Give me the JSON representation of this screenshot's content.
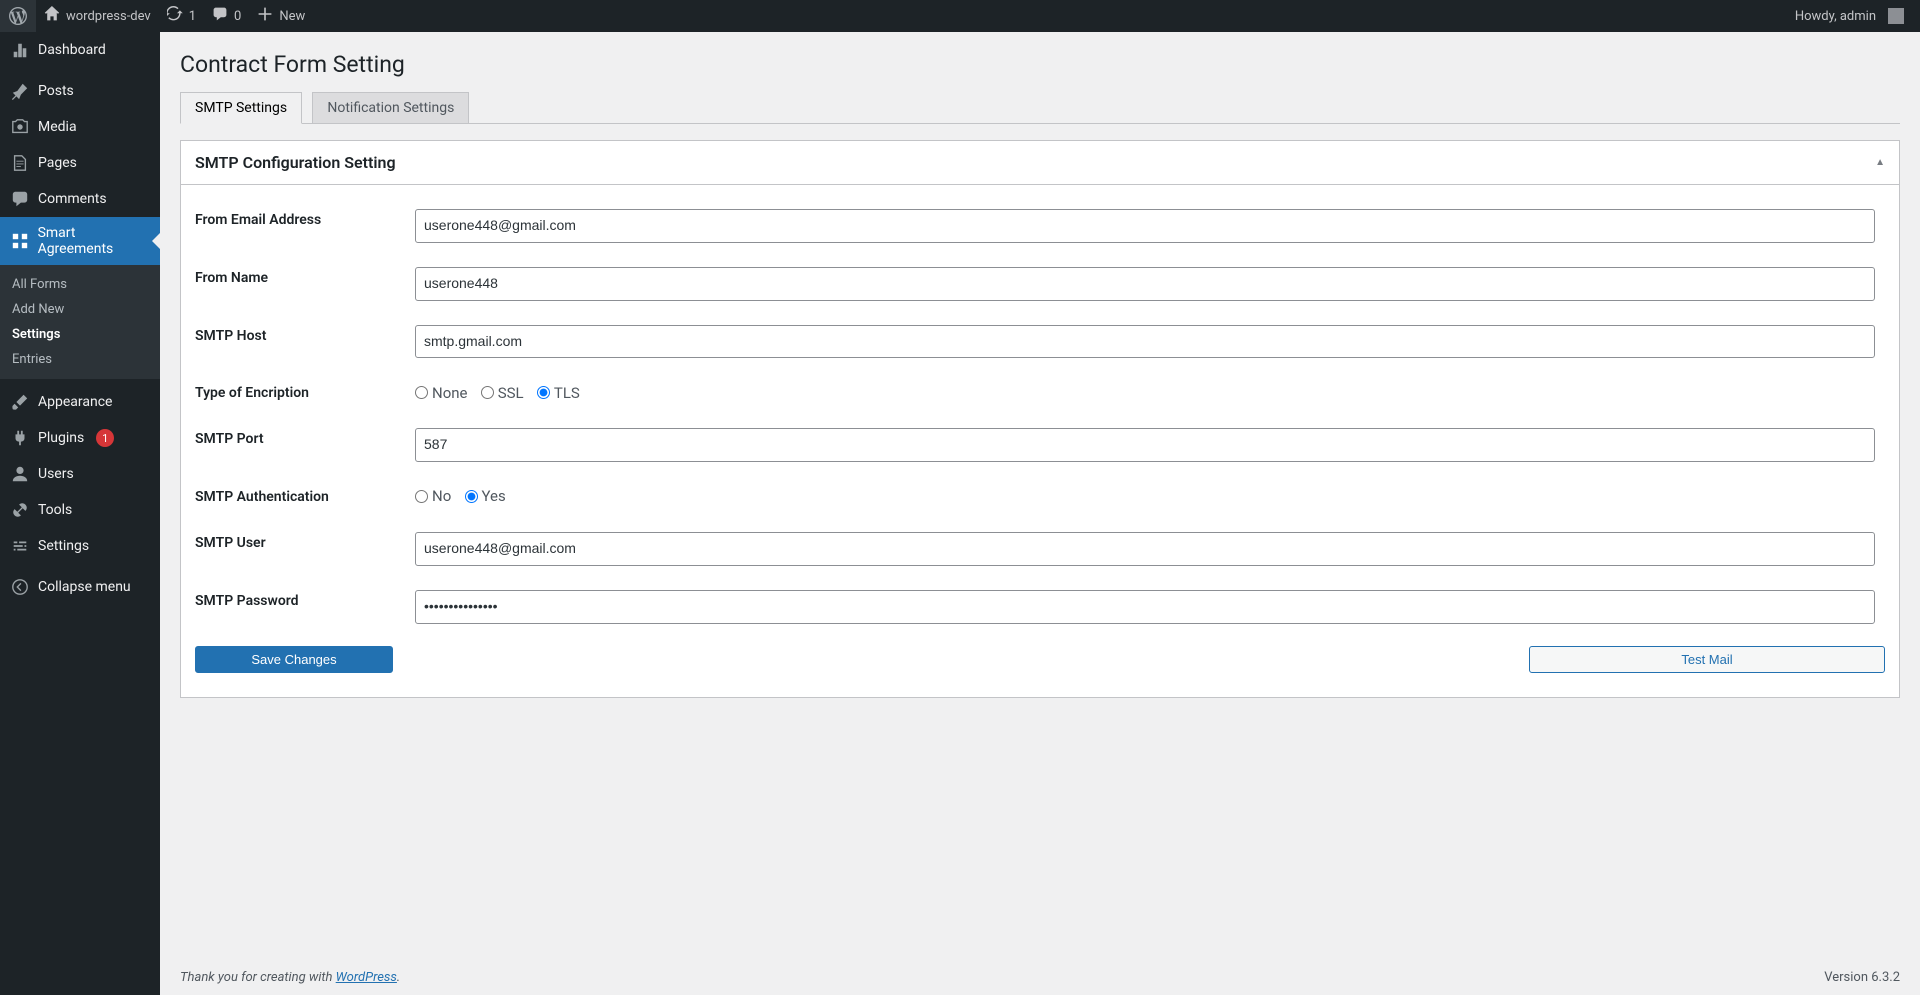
{
  "adminbar": {
    "site_name": "wordpress-dev",
    "updates_count": "1",
    "comments_count": "0",
    "new_label": "New",
    "howdy": "Howdy, admin"
  },
  "sidebar": {
    "dashboard": "Dashboard",
    "posts": "Posts",
    "media": "Media",
    "pages": "Pages",
    "comments": "Comments",
    "smart_agreements": "Smart Agreements",
    "sub_all_forms": "All Forms",
    "sub_add_new": "Add New",
    "sub_settings": "Settings",
    "sub_entries": "Entries",
    "appearance": "Appearance",
    "plugins": "Plugins",
    "plugins_badge": "1",
    "users": "Users",
    "tools": "Tools",
    "settings": "Settings",
    "collapse": "Collapse menu"
  },
  "page": {
    "title": "Contract Form Setting"
  },
  "tabs": {
    "smtp": "SMTP Settings",
    "notification": "Notification Settings"
  },
  "panel": {
    "title": "SMTP Configuration Setting"
  },
  "form": {
    "from_email_label": "From Email Address",
    "from_email_value": "userone448@gmail.com",
    "from_name_label": "From Name",
    "from_name_value": "userone448",
    "smtp_host_label": "SMTP Host",
    "smtp_host_value": "smtp.gmail.com",
    "encryption_label": "Type of Encription",
    "enc_none": "None",
    "enc_ssl": "SSL",
    "enc_tls": "TLS",
    "enc_selected": "TLS",
    "smtp_port_label": "SMTP Port",
    "smtp_port_value": "587",
    "smtp_auth_label": "SMTP Authentication",
    "auth_no": "No",
    "auth_yes": "Yes",
    "auth_selected": "Yes",
    "smtp_user_label": "SMTP User",
    "smtp_user_value": "userone448@gmail.com",
    "smtp_pass_label": "SMTP Password",
    "smtp_pass_value": "•••••••••••••••",
    "save_label": "Save Changes",
    "test_label": "Test Mail"
  },
  "footer": {
    "credit_prefix": "Thank you for creating with ",
    "credit_link": "WordPress",
    "credit_suffix": ".",
    "version": "Version 6.3.2"
  }
}
